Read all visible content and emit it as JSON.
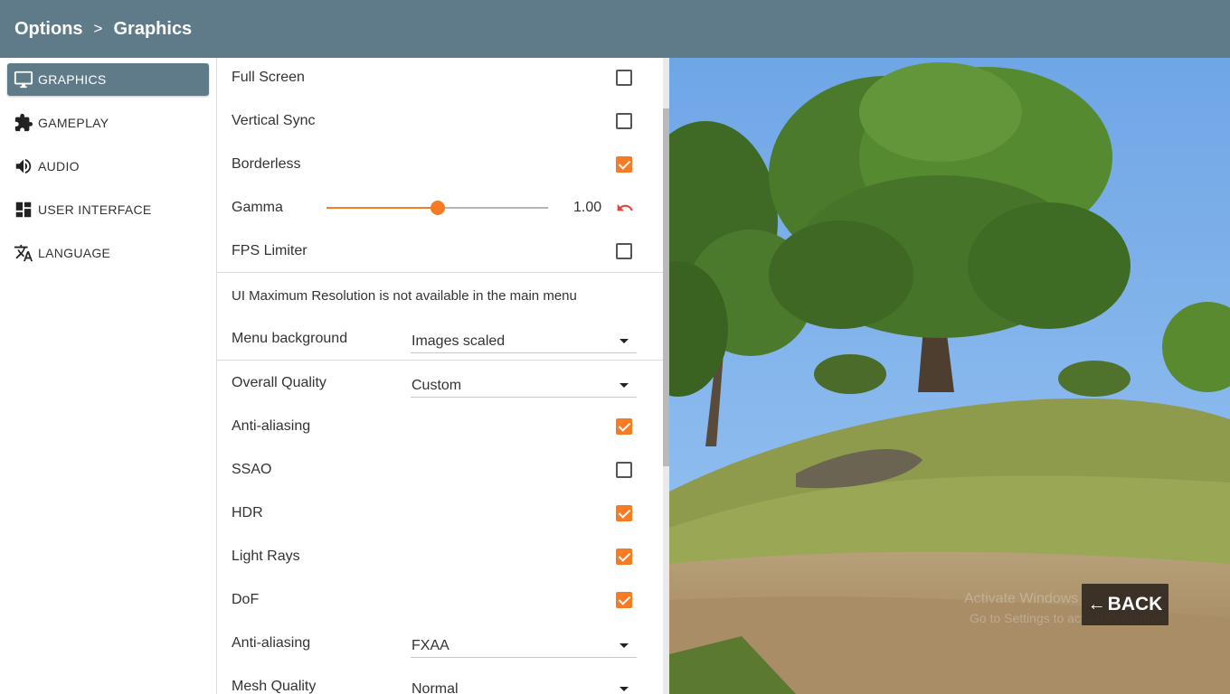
{
  "header": {
    "crumb_options": "Options",
    "separator": ">",
    "crumb_graphics": "Graphics"
  },
  "sidebar": {
    "items": [
      {
        "label": "GRAPHICS",
        "icon": "monitor-icon",
        "active": true
      },
      {
        "label": "GAMEPLAY",
        "icon": "puzzle-icon",
        "active": false
      },
      {
        "label": "AUDIO",
        "icon": "speaker-icon",
        "active": false
      },
      {
        "label": "USER INTERFACE",
        "icon": "dashboard-icon",
        "active": false
      },
      {
        "label": "LANGUAGE",
        "icon": "translate-icon",
        "active": false
      }
    ]
  },
  "settings": {
    "full_screen": {
      "label": "Full Screen",
      "checked": false
    },
    "vertical_sync": {
      "label": "Vertical Sync",
      "checked": false
    },
    "borderless": {
      "label": "Borderless",
      "checked": true
    },
    "gamma": {
      "label": "Gamma",
      "value": "1.00",
      "slider_fraction": 0.5
    },
    "fps_limiter": {
      "label": "FPS Limiter",
      "checked": false
    },
    "ui_max_res_note": "UI Maximum Resolution is not available in the main menu",
    "menu_background": {
      "label": "Menu background",
      "value": "Images scaled"
    },
    "overall_quality": {
      "label": "Overall Quality",
      "value": "Custom"
    },
    "anti_aliasing_toggle": {
      "label": "Anti-aliasing",
      "checked": true
    },
    "ssao": {
      "label": "SSAO",
      "checked": false
    },
    "hdr": {
      "label": "HDR",
      "checked": true
    },
    "light_rays": {
      "label": "Light Rays",
      "checked": true
    },
    "dof": {
      "label": "DoF",
      "checked": true
    },
    "anti_aliasing_mode": {
      "label": "Anti-aliasing",
      "value": "FXAA"
    },
    "mesh_quality": {
      "label": "Mesh Quality",
      "value": "Normal"
    }
  },
  "back_button": {
    "label": "BACK",
    "arrow": "←"
  },
  "watermark": {
    "line1": "Activate Windows",
    "line2": "Go to Settings to activate Windows."
  },
  "colors": {
    "header": "#5f7b8a",
    "accent": "#f57b25",
    "reset": "#e0463c"
  }
}
